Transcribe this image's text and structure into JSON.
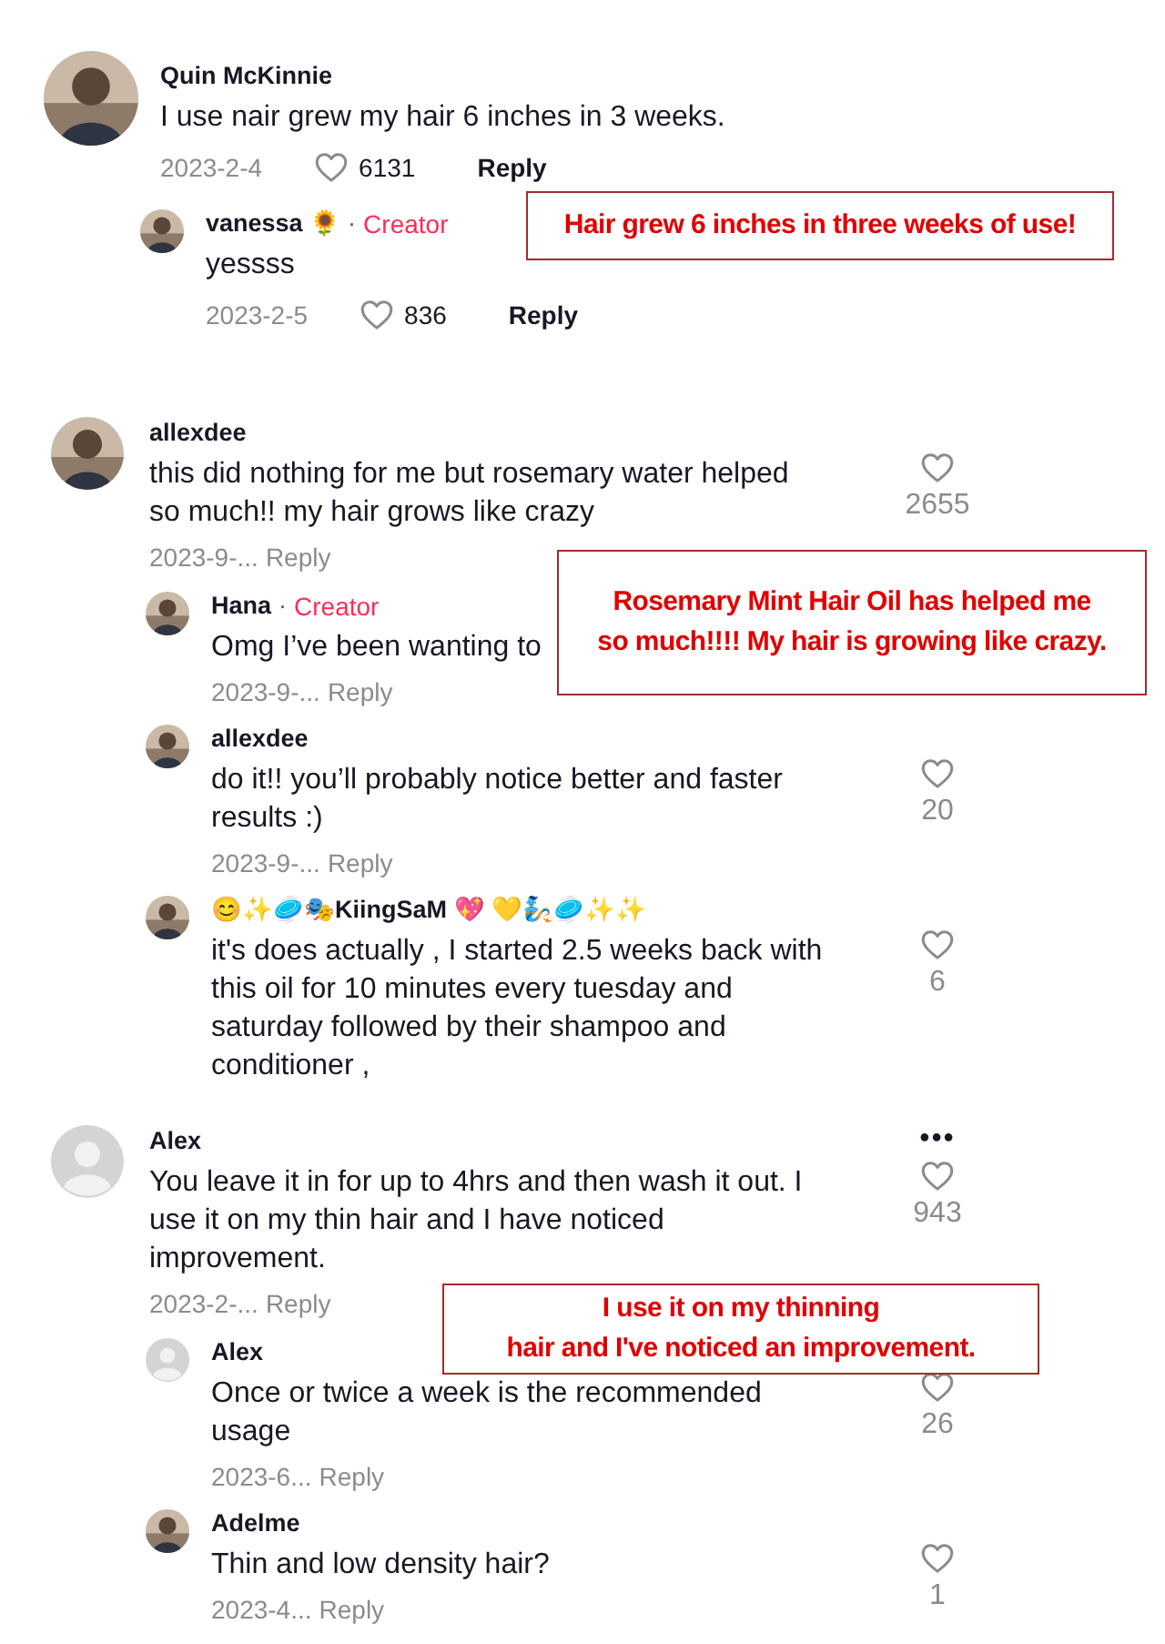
{
  "threads": [
    {
      "kind": "inline",
      "comment": {
        "author": "Quin McKinnie",
        "text": "I use nair grew my hair 6 inches in 3 weeks.",
        "date": "2023-2-4",
        "likes": "6131",
        "reply": "Reply"
      },
      "replies": [
        {
          "author": "vanessa 🌻",
          "separator": "·",
          "badge": "Creator",
          "text": "yessss",
          "date": "2023-2-5",
          "likes": "836",
          "reply": "Reply"
        }
      ]
    },
    {
      "kind": "side",
      "comment": {
        "author": "allexdee",
        "text": "this did nothing for me but rosemary water helped so much!! my hair grows like crazy",
        "date": "2023-9-...",
        "likes": "2655",
        "reply": "Reply"
      },
      "replies": [
        {
          "author": "Hana",
          "separator": "·",
          "badge": "Creator",
          "text": "Omg I’ve been wanting to",
          "date": "2023-9-...",
          "reply": "Reply"
        },
        {
          "author": "allexdee",
          "text": "do it!! you’ll probably notice better and faster results :)",
          "date": "2023-9-...",
          "likes": "20",
          "reply": "Reply"
        },
        {
          "author": "😊✨🥏🎭KiingSaM 💖 💛🧞🥏✨✨",
          "text": "it's does actually , I started 2.5 weeks back with this oil for 10 minutes every tuesday and saturday followed by their shampoo and conditioner ,",
          "likes": "6"
        }
      ]
    },
    {
      "kind": "side",
      "comment": {
        "author": "Alex",
        "kind": "default",
        "more": "•••",
        "text": "You leave it in for up to 4hrs and then wash it out. I use it on my thin hair and I have noticed improvement.",
        "date": "2023-2-...",
        "likes": "943",
        "reply": "Reply"
      },
      "replies": [
        {
          "author": "Alex",
          "kind": "default",
          "text": "Once or twice a week is the recommended usage",
          "date": "2023-6...",
          "likes": "26",
          "reply": "Reply"
        },
        {
          "author": "Adelme",
          "text": "Thin and low density hair?",
          "date": "2023-4...",
          "likes": "1",
          "reply": "Reply"
        }
      ]
    }
  ],
  "callouts": [
    {
      "lines": [
        "Hair grew 6 inches in three weeks of use!"
      ]
    },
    {
      "lines": [
        "Rosemary Mint Hair Oil has helped me",
        "so much!!!! My hair is growing like crazy."
      ]
    },
    {
      "lines": [
        "I use it on my thinning",
        "hair and I've noticed an improvement."
      ]
    }
  ]
}
